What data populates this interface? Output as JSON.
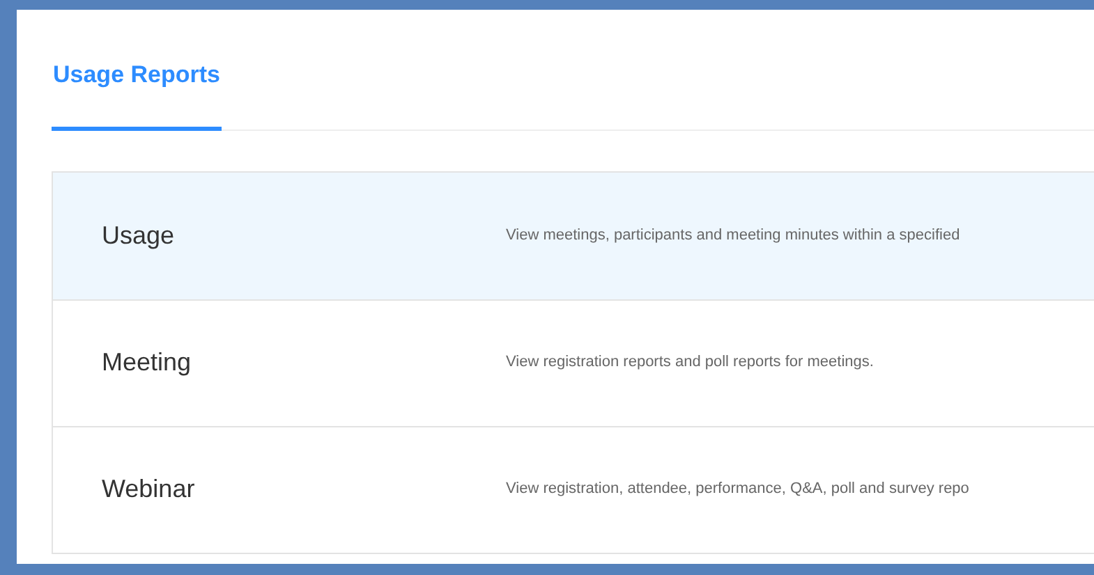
{
  "tabs": [
    {
      "label": "Usage Reports",
      "selected": true
    }
  ],
  "reports": [
    {
      "name": "Usage",
      "description": "View meetings, participants and meeting minutes within a specified",
      "selected": true
    },
    {
      "name": "Meeting",
      "description": "View registration reports and poll reports for meetings.",
      "selected": false
    },
    {
      "name": "Webinar",
      "description": "View registration, attendee, performance, Q&A, poll and survey repo",
      "selected": false
    }
  ]
}
